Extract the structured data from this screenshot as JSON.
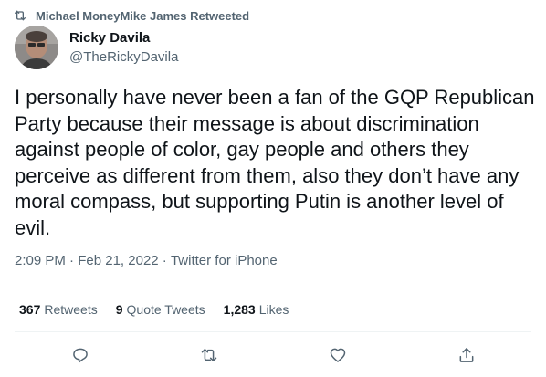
{
  "retweeted_by": "Michael MoneyMike James Retweeted",
  "author": {
    "name": "Ricky Davila",
    "handle": "@TheRickyDavila"
  },
  "tweet": {
    "text": "I personally have never been a fan of the GQP Republican Party because their message is about discrimination against people of color, gay people and others they perceive as different from them, also they don’t have any moral compass, but supporting Putin is another level of evil.",
    "time": "2:09 PM",
    "separator": " · ",
    "date": "Feb 21, 2022",
    "source": "Twitter for iPhone"
  },
  "stats": {
    "retweets_count": "367",
    "retweets_label": "Retweets",
    "quote_count": "9",
    "quote_label": "Quote Tweets",
    "likes_count": "1,283",
    "likes_label": "Likes"
  },
  "icons": {
    "retweet_indicator": "retweet-icon",
    "reply": "reply-icon",
    "retweet": "retweet-icon",
    "like": "heart-icon",
    "share": "share-icon"
  },
  "colors": {
    "text": "#0f1419",
    "secondary": "#536471",
    "divider": "#eff3f4"
  }
}
